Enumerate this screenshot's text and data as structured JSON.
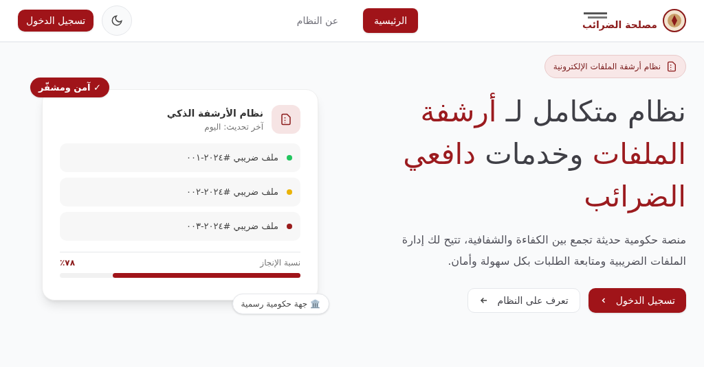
{
  "header": {
    "brand": "مصلحة الضرائب",
    "nav": [
      {
        "label": "الرئيسية",
        "selected": true
      },
      {
        "label": "عن النظام",
        "selected": false
      }
    ],
    "login_button": "تسجيل الدخول"
  },
  "hero": {
    "badge": "نظام أرشفة الملفات الإلكترونية",
    "headline": [
      {
        "text": "نظام متكامل لـ ",
        "accent": false
      },
      {
        "text": "أرشفة الملفات",
        "accent": true
      },
      {
        "text": " وخدمات ",
        "accent": false
      },
      {
        "text": "دافعي الضرائب",
        "accent": true
      }
    ],
    "description": "منصة حكومية حديثة تجمع بين الكفاءة والشفافية، تتيح لك إدارة الملفات الضريبية ومتابعة الطلبات بكل سهولة وأمان.",
    "primary_button": "تسجيل الدخول",
    "secondary_button": "تعرف على النظام"
  },
  "card": {
    "ribbon": "✓ آمن ومشفّر",
    "title": "نظام الأرشفة الذكي",
    "subtitle": "آخر تحديث: اليوم",
    "files": [
      {
        "label": "ملف ضريبي #٢٠٢٤-٠٠١",
        "color": "#22c55e"
      },
      {
        "label": "ملف ضريبي #٢٠٢٤-٠٠٢",
        "color": "#eab308"
      },
      {
        "label": "ملف ضريبي #٢٠٢٤-٠٠٣",
        "color": "#991b1b"
      }
    ],
    "progress": {
      "label": "نسبة الإنجاز",
      "reading": "٧٨٪",
      "level": 0.78
    },
    "footer_badge": "🏛️ جهة حكومية رسمية"
  }
}
